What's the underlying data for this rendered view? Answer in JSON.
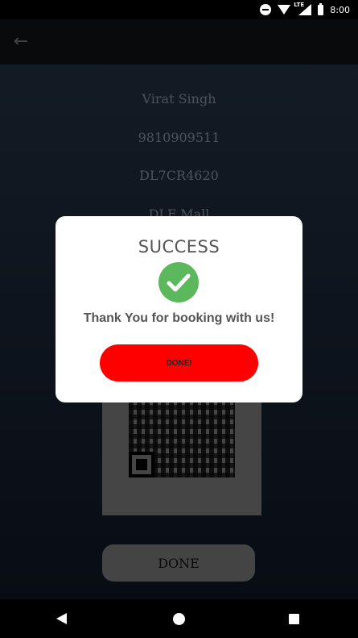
{
  "status_bar": {
    "time": "8:00",
    "network": "LTE"
  },
  "booking": {
    "name": "Virat Singh",
    "phone": "9810909511",
    "vehicle_number": "DL7CR4620",
    "location": "DLF Mall"
  },
  "bottom_button": {
    "label": "DONE"
  },
  "dialog": {
    "title": "SUCCESS",
    "message": "Thank You for booking with us!",
    "button_label": "DONE!",
    "icon": "check-circle-icon",
    "accent_color": "#5cb85c",
    "button_color": "#ff0000"
  }
}
